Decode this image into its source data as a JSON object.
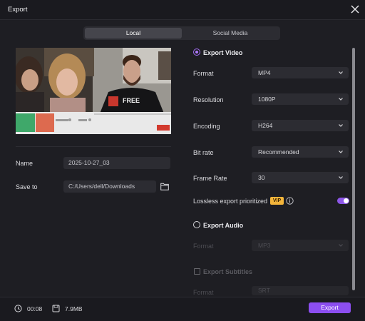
{
  "window": {
    "title": "Export"
  },
  "tabs": [
    {
      "label": "Local"
    },
    {
      "label": "Social Media"
    }
  ],
  "left": {
    "name_label": "Name",
    "name_value": "2025-10-27_03",
    "save_label": "Save to",
    "save_value": "C:/Users/dell/Downloads"
  },
  "export_video": {
    "label": "Export Video",
    "rows": [
      {
        "label": "Format",
        "value": "MP4"
      },
      {
        "label": "Resolution",
        "value": "1080P"
      },
      {
        "label": "Encoding",
        "value": "H264"
      },
      {
        "label": "Bit rate",
        "value": "Recommended"
      },
      {
        "label": "Frame Rate",
        "value": "30"
      }
    ],
    "lossless_label": "Lossless export prioritized",
    "vip_badge": "VIP",
    "lossless_enabled": true
  },
  "export_audio": {
    "label": "Export Audio",
    "format_label": "Format",
    "format_value": "MP3"
  },
  "export_subtitles": {
    "label": "Export Subtitles",
    "format_label": "Format",
    "format_value": "SRT"
  },
  "footer": {
    "duration": "00:08",
    "size": "7.9MB",
    "export_label": "Export"
  },
  "colors": {
    "accent": "#8c4ef0",
    "background": "#1e1e23",
    "vip": "#f4b53b"
  }
}
